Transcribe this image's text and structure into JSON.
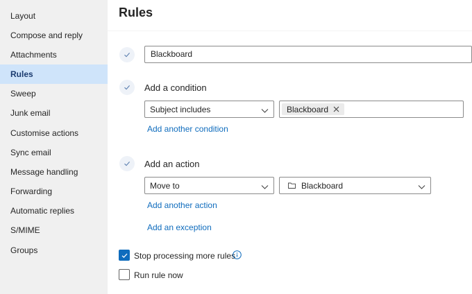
{
  "sidebar": {
    "items": [
      {
        "label": "Layout"
      },
      {
        "label": "Compose and reply"
      },
      {
        "label": "Attachments"
      },
      {
        "label": "Rules"
      },
      {
        "label": "Sweep"
      },
      {
        "label": "Junk email"
      },
      {
        "label": "Customise actions"
      },
      {
        "label": "Sync email"
      },
      {
        "label": "Message handling"
      },
      {
        "label": "Forwarding"
      },
      {
        "label": "Automatic replies"
      },
      {
        "label": "S/MIME"
      },
      {
        "label": "Groups"
      }
    ],
    "selected": "Rules"
  },
  "main": {
    "title": "Rules",
    "rule_name_value": "Blackboard",
    "condition": {
      "label": "Add a condition",
      "type_value": "Subject includes",
      "tag": "Blackboard",
      "add_link": "Add another condition"
    },
    "action": {
      "label": "Add an action",
      "type_value": "Move to",
      "folder_value": "Blackboard",
      "add_link": "Add another action"
    },
    "exception_link": "Add an exception",
    "stop_processing": {
      "label": "Stop processing more rules",
      "checked": true
    },
    "run_now": {
      "label": "Run rule now",
      "checked": false
    }
  },
  "colors": {
    "accent": "#0f6cbd",
    "selected_bg": "#cfe4fa",
    "sidebar_bg": "#f0f0f0"
  }
}
